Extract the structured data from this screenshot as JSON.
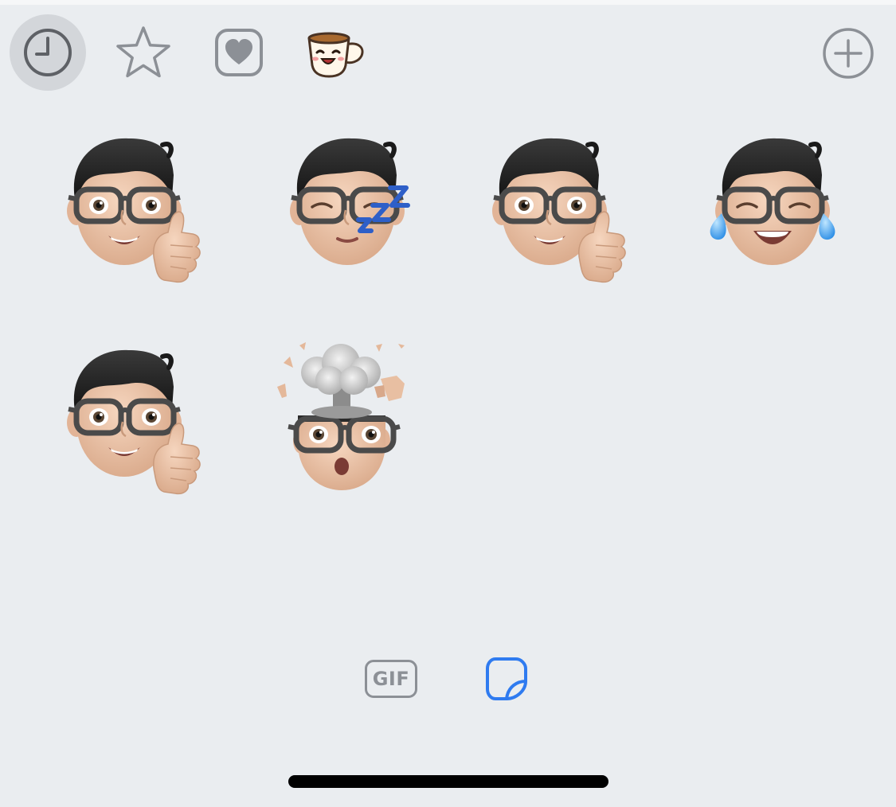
{
  "tabs": [
    {
      "id": "recent",
      "icon": "clock-icon",
      "selected": true
    },
    {
      "id": "favorites",
      "icon": "star-icon",
      "selected": false
    },
    {
      "id": "memoji",
      "icon": "heart-square-icon",
      "selected": false
    },
    {
      "id": "coffee-sticker-pack",
      "icon": "coffee-cup-icon",
      "selected": false
    },
    {
      "id": "add",
      "icon": "plus-circle-icon",
      "selected": false
    }
  ],
  "stickers": [
    {
      "name": "memoji-thumbs-up"
    },
    {
      "name": "memoji-sleeping"
    },
    {
      "name": "memoji-thumbs-up"
    },
    {
      "name": "memoji-tears-of-joy"
    },
    {
      "name": "memoji-thumbs-up"
    },
    {
      "name": "memoji-mind-blown"
    }
  ],
  "mode_switch": {
    "gif_label": "GIF",
    "active_mode": "stickers"
  },
  "colors": {
    "background": "#eaedf0",
    "icon_gray": "#8c9096",
    "accent_blue": "#2f7bf0",
    "selected_tab_bg": "#d3d6da"
  }
}
